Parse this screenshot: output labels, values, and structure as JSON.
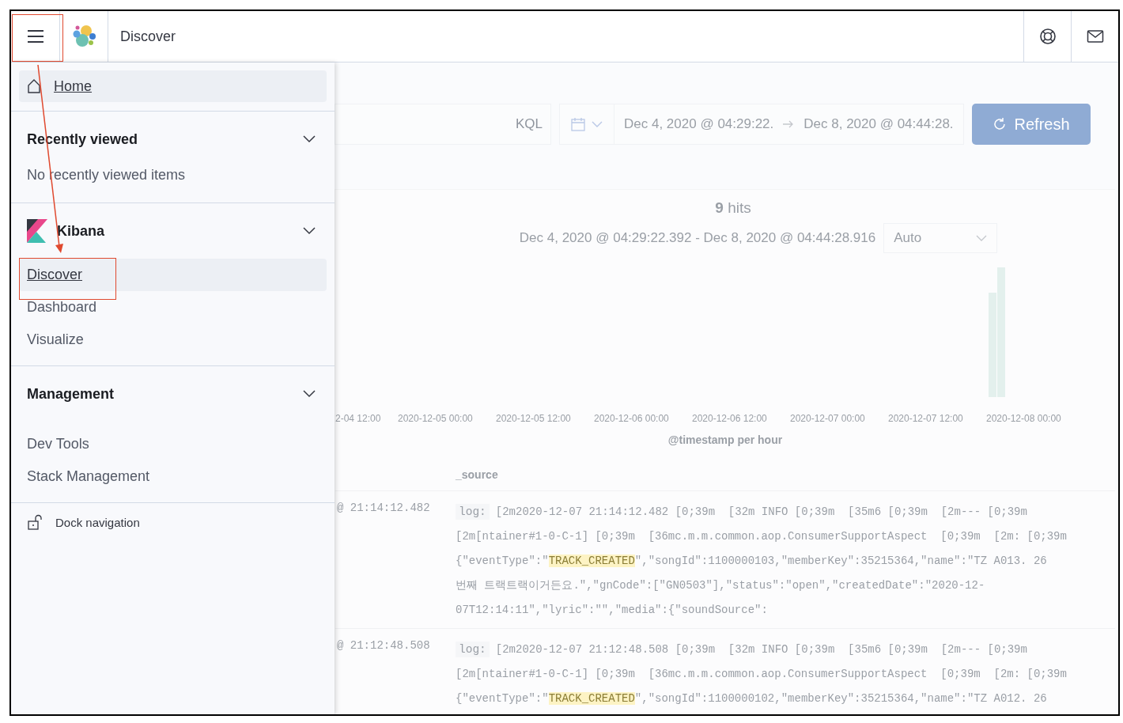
{
  "header": {
    "title": "Discover"
  },
  "nav": {
    "home": {
      "label": "Home",
      "selected": false
    },
    "sections": [
      {
        "kind": "recent",
        "title": "Recently viewed",
        "expanded": true,
        "empty_text": "No recently viewed items"
      },
      {
        "kind": "app",
        "title": "Kibana",
        "expanded": true,
        "items": [
          {
            "label": "Discover",
            "selected": true
          },
          {
            "label": "Dashboard",
            "selected": false
          },
          {
            "label": "Visualize",
            "selected": false
          }
        ]
      },
      {
        "kind": "plain",
        "title": "Management",
        "expanded": true,
        "items": [
          {
            "label": "Dev Tools",
            "selected": false
          },
          {
            "label": "Stack Management",
            "selected": false
          }
        ]
      }
    ],
    "dock": {
      "label": "Dock navigation"
    }
  },
  "query_bar": {
    "language": "KQL",
    "start": "Dec 4, 2020 @ 04:29:22.",
    "end": "Dec 8, 2020 @ 04:44:28.",
    "refresh": "Refresh"
  },
  "histogram": {
    "hits": "**9** hits",
    "range": "Dec 4, 2020 @ 04:29:22.392 - Dec 8, 2020 @ 04:44:28.916",
    "interval": "Auto",
    "x_labels": [
      "2-04 12:00",
      "2020-12-05 00:00",
      "2020-12-05 12:00",
      "2020-12-06 00:00",
      "2020-12-06 12:00",
      "2020-12-07 00:00",
      "2020-12-07 12:00",
      "2020-12-08 00:00"
    ],
    "axis_title": "@timestamp per hour"
  },
  "documents": {
    "column": "_source",
    "rows": [
      {
        "time": "@ 21:14:12.482",
        "field": "log:",
        "lines": [
          [
            {
              "text": "[2m2020-12-07 21:14:12.482 [0;39m  [32m INFO [0;39m  [35m6 [0;39m  [2m--- [0;39m",
              "highlight": false
            }
          ],
          [
            {
              "text": "[2m[ntainer#1-0-C-1] [0;39m  [36mc.m.m.common.aop.ConsumerSupportAspect  [0;39m  [2m: [0;39m",
              "highlight": false
            }
          ],
          [
            {
              "text": "{\"eventType\":\"",
              "highlight": false
            },
            {
              "text": "TRACK_CREATED",
              "highlight": true
            },
            {
              "text": "\",\"songId\":1100000103,\"memberKey\":35215364,\"name\":\"TZ A013. 26",
              "highlight": false
            }
          ],
          [
            {
              "text": "번째 트랙트랙이거든요.\",\"gnCode\":[\"GN0503\"],\"status\":\"open\",\"createdDate\":\"2020-12-",
              "highlight": false
            }
          ],
          [
            {
              "text": "07T12:14:11\",\"lyric\":\"\",\"media\":{\"soundSource\":",
              "highlight": false
            }
          ]
        ]
      },
      {
        "time": "@ 21:12:48.508",
        "field": "log:",
        "lines": [
          [
            {
              "text": "[2m2020-12-07 21:12:48.508 [0;39m  [32m INFO [0;39m  [35m6 [0;39m  [2m--- [0;39m",
              "highlight": false
            }
          ],
          [
            {
              "text": "[2m[ntainer#1-0-C-1] [0;39m  [36mc.m.m.common.aop.ConsumerSupportAspect  [0;39m  [2m: [0;39m",
              "highlight": false
            }
          ],
          [
            {
              "text": "{\"eventType\":\"",
              "highlight": false
            },
            {
              "text": "TRACK_CREATED",
              "highlight": true
            },
            {
              "text": "\",\"songId\":1100000102,\"memberKey\":35215364,\"name\":\"TZ A012. 26",
              "highlight": false
            }
          ]
        ]
      }
    ]
  }
}
